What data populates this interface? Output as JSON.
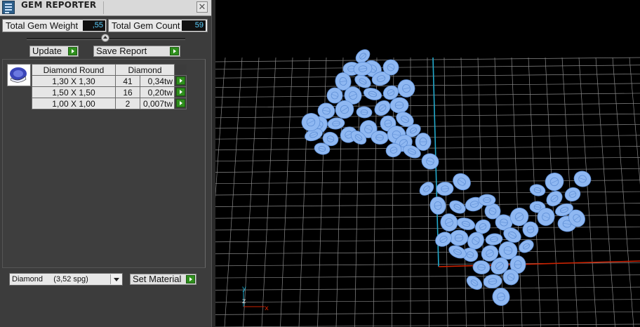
{
  "window": {
    "title": "GEM REPORTER",
    "close_glyph": "✕"
  },
  "totals": {
    "weight_label": "Total Gem Weight",
    "weight_value": ",55",
    "count_label": "Total Gem Count",
    "count_value": "59"
  },
  "toolbar": {
    "update_label": "Update",
    "save_report_label": "Save Report"
  },
  "gem_table": {
    "headers": [
      "Diamond Round",
      "Diamond"
    ],
    "rows": [
      {
        "size": "1,30 X 1,30",
        "count": "41",
        "weight": "0,34tw"
      },
      {
        "size": "1,50 X 1,50",
        "count": "16",
        "weight": "0,20tw"
      },
      {
        "size": "1,00 X 1,00",
        "count": "2",
        "weight": "0,007tw"
      }
    ]
  },
  "material": {
    "selected": "Diamond     (3,52 spg)",
    "set_label": "Set Material"
  },
  "viewport": {
    "axis_labels": {
      "y": "y",
      "z": "z",
      "x": "x"
    },
    "colors": {
      "background": "#000000",
      "grid": "#8a8a8a",
      "gem_fill": "#8fb8f2",
      "gem_stroke": "#5f8fd6",
      "axis_x": "#cc2200",
      "axis_y": "#22aacc"
    }
  },
  "icons": {
    "app": "gem-reporter-app-icon",
    "close": "close-icon",
    "go": "green-play-arrow-icon",
    "gem_preview": "round-diamond-icon",
    "dropdown": "chevron-down-icon"
  }
}
